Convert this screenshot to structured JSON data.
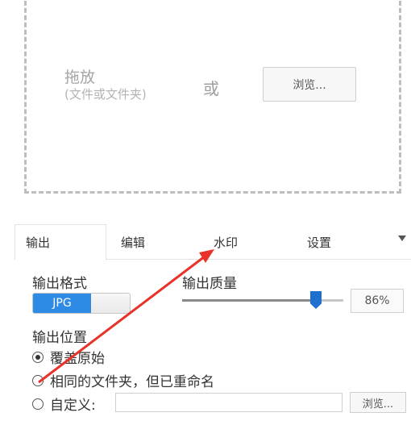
{
  "drop_zone": {
    "title": "拖放",
    "subtitle": "(文件或文件夹)",
    "or_text": "或",
    "browse_label": "浏览..."
  },
  "tabs": [
    {
      "label": "输出",
      "active": true
    },
    {
      "label": "编辑",
      "active": false
    },
    {
      "label": "水印",
      "active": false
    },
    {
      "label": "设置",
      "active": false
    }
  ],
  "output": {
    "format_label": "输出格式",
    "format_value": "JPG",
    "quality_label": "输出质量",
    "quality_value": "86%",
    "quality_fraction": 0.86,
    "location_label": "输出位置",
    "options": [
      {
        "label": "覆盖原始",
        "checked": true
      },
      {
        "label": "相同的文件夹，但已重命名",
        "checked": false
      },
      {
        "label": "自定义:",
        "checked": false
      }
    ],
    "custom_path_value": "",
    "browse_label": "浏览..."
  },
  "colors": {
    "accent": "#2d8be6",
    "annotation_arrow": "#e8322a"
  }
}
